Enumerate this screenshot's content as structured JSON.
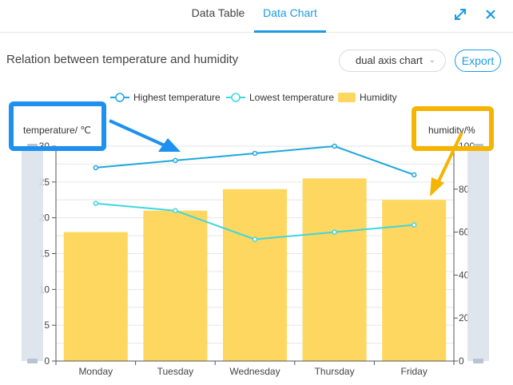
{
  "tabs": [
    {
      "label": "Data Table",
      "active": false
    },
    {
      "label": "Data Chart",
      "active": true
    }
  ],
  "icons": {
    "expand": "expand-arrows-icon",
    "close": "close-x-icon"
  },
  "header": {
    "title": "Relation between temperature and humidity",
    "chart_type_value": "dual axis chart",
    "export_label": "Export"
  },
  "colors": {
    "accent": "#1a9be6",
    "highest": "#1ea7dd",
    "lowest": "#3fd6e0",
    "humidity": "#fdd75f",
    "callout_blue": "#1e90f0",
    "callout_yellow": "#f5b400",
    "slider": "#dbe2eb"
  },
  "chart_data": {
    "type": "bar",
    "categories": [
      "Monday",
      "Tuesday",
      "Wednesday",
      "Thursday",
      "Friday"
    ],
    "series": [
      {
        "name": "Highest temperature",
        "type": "line",
        "axis": "left",
        "values": [
          27,
          28,
          29,
          30,
          26
        ]
      },
      {
        "name": "Lowest temperature",
        "type": "line",
        "axis": "left",
        "values": [
          22,
          21,
          17,
          18,
          19
        ]
      },
      {
        "name": "Humidity",
        "type": "bar",
        "axis": "right",
        "values": [
          60,
          70,
          80,
          85,
          75
        ]
      }
    ],
    "y_left": {
      "label": "temperature/ ℃",
      "ylim": [
        0,
        30
      ],
      "ticks": [
        0,
        5,
        10,
        15,
        20,
        25,
        30
      ]
    },
    "y_right": {
      "label": "humidity/%",
      "ylim": [
        0,
        100
      ],
      "ticks": [
        0,
        20,
        40,
        60,
        80,
        100
      ]
    },
    "legend": "top-center",
    "grid": true
  }
}
